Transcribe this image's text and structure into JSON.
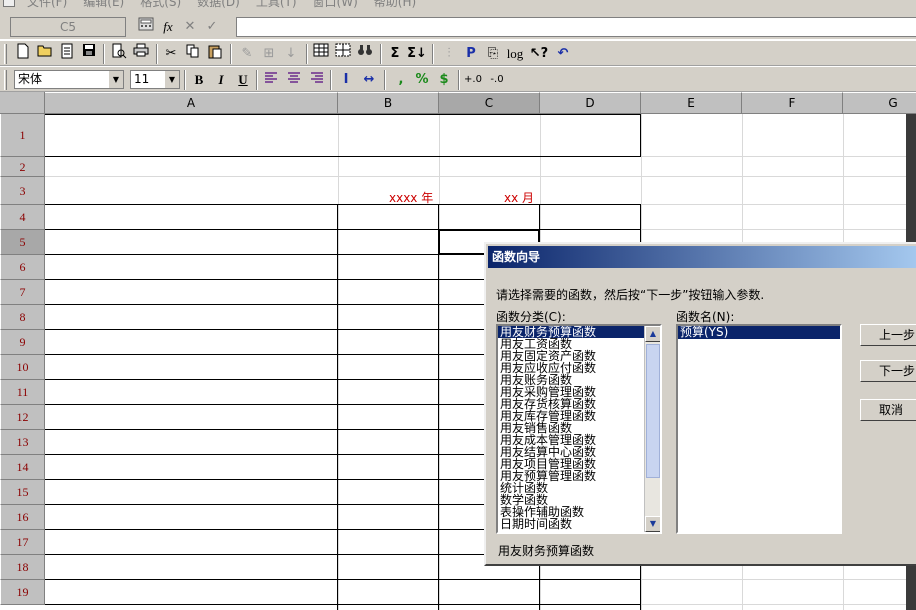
{
  "menubar": {
    "items": [
      "文件(F)",
      "编辑(E)",
      "格式(S)",
      "数据(D)",
      "工具(T)",
      "窗口(W)",
      "帮助(H)"
    ]
  },
  "formula_bar": {
    "cell_ref": "C5",
    "fx_label": "fx",
    "formula_value": ""
  },
  "toolbar2": {
    "font_name": "宋体",
    "font_size": "11"
  },
  "columns": [
    "A",
    "B",
    "C",
    "D",
    "E",
    "F",
    "G"
  ],
  "rows": [
    "1",
    "2",
    "3",
    "4",
    "5",
    "6",
    "7",
    "8",
    "9",
    "10",
    "11",
    "12",
    "13",
    "14",
    "15",
    "16",
    "17",
    "18",
    "19"
  ],
  "active_cell": {
    "column": "C",
    "row": "5"
  },
  "cells": {
    "b3": "xxxx 年",
    "c3": "xx 月"
  },
  "dialog": {
    "title": "函数向导",
    "instruction": "请选择需要的函数，然后按“下一步”按钮输入参数.",
    "category_label": "函数分类(C):",
    "name_label": "函数名(N):",
    "categories": [
      "用友财务预算函数",
      "用友工资函数",
      "用友固定资产函数",
      "用友应收应付函数",
      "用友账务函数",
      "用友采购管理函数",
      "用友存货核算函数",
      "用友库存管理函数",
      "用友销售函数",
      "用友成本管理函数",
      "用友结算中心函数",
      "用友项目管理函数",
      "用友预算管理函数",
      "统计函数",
      "数学函数",
      "表操作辅助函数",
      "日期时间函数"
    ],
    "selected_category": "用友财务预算函数",
    "functions": [
      "预算(YS)"
    ],
    "selected_function": "预算(YS)",
    "buttons": {
      "prev": "上一步",
      "next": "下一步",
      "cancel": "取消"
    },
    "status_text": "用友财务预算函数"
  }
}
